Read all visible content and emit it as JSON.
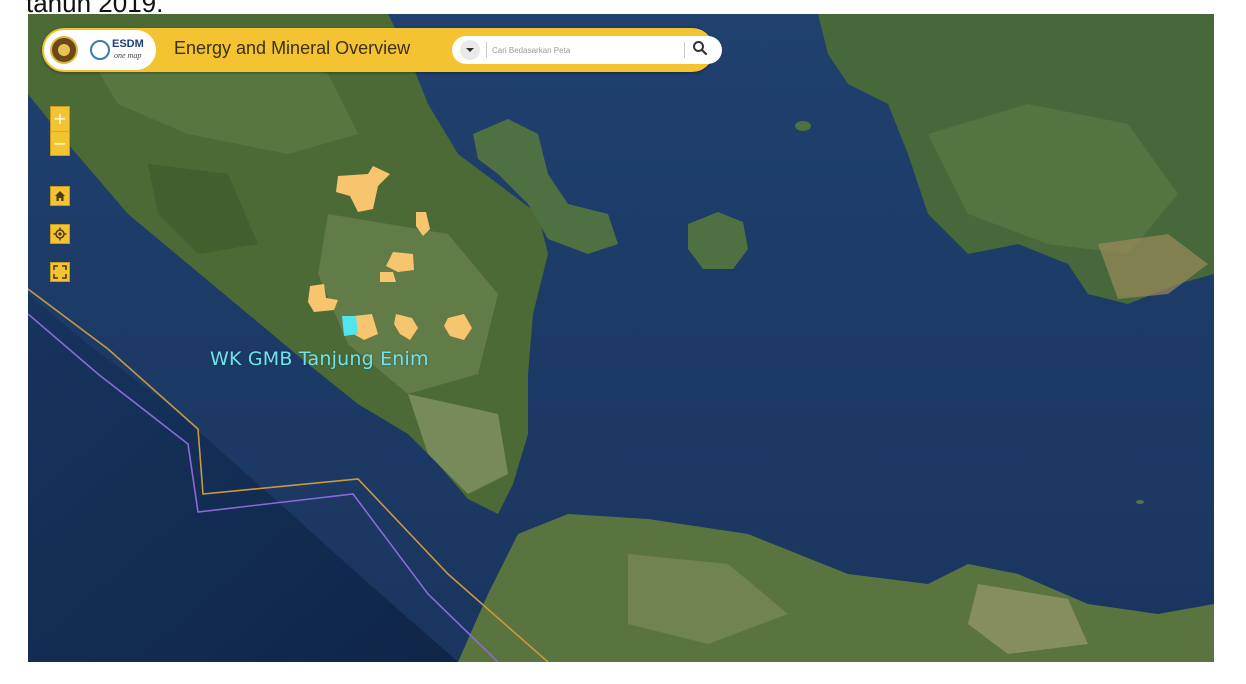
{
  "caption": "tahun 2019.",
  "app": {
    "title": "Energy and Mineral Overview",
    "logo_text": "ESDM",
    "logo_subtext": "one map"
  },
  "search": {
    "placeholder": "Cari Bedasarkan Peta"
  },
  "icons": {
    "dropdown": "chevron-down-icon",
    "search": "search-icon",
    "zoom_in": "plus-icon",
    "zoom_out": "minus-icon",
    "home": "home-icon",
    "locate": "crosshair-icon",
    "fullscreen": "fullscreen-icon"
  },
  "controls": {
    "zoom_in_label": "+",
    "zoom_out_label": "−"
  },
  "map": {
    "feature_label": "WK GMB Tanjung Enim",
    "feature_label_color": "#6fe3e8",
    "polygon_fill_color": "#f7c56e",
    "highlight_fill_color": "#4fe6ee",
    "water_color": "#1c3a67",
    "land_color": "#4a6a3a",
    "toolbar_color": "#f3c331",
    "boundary_line_colors": [
      "#c79a3f",
      "#8a6ad8"
    ]
  }
}
